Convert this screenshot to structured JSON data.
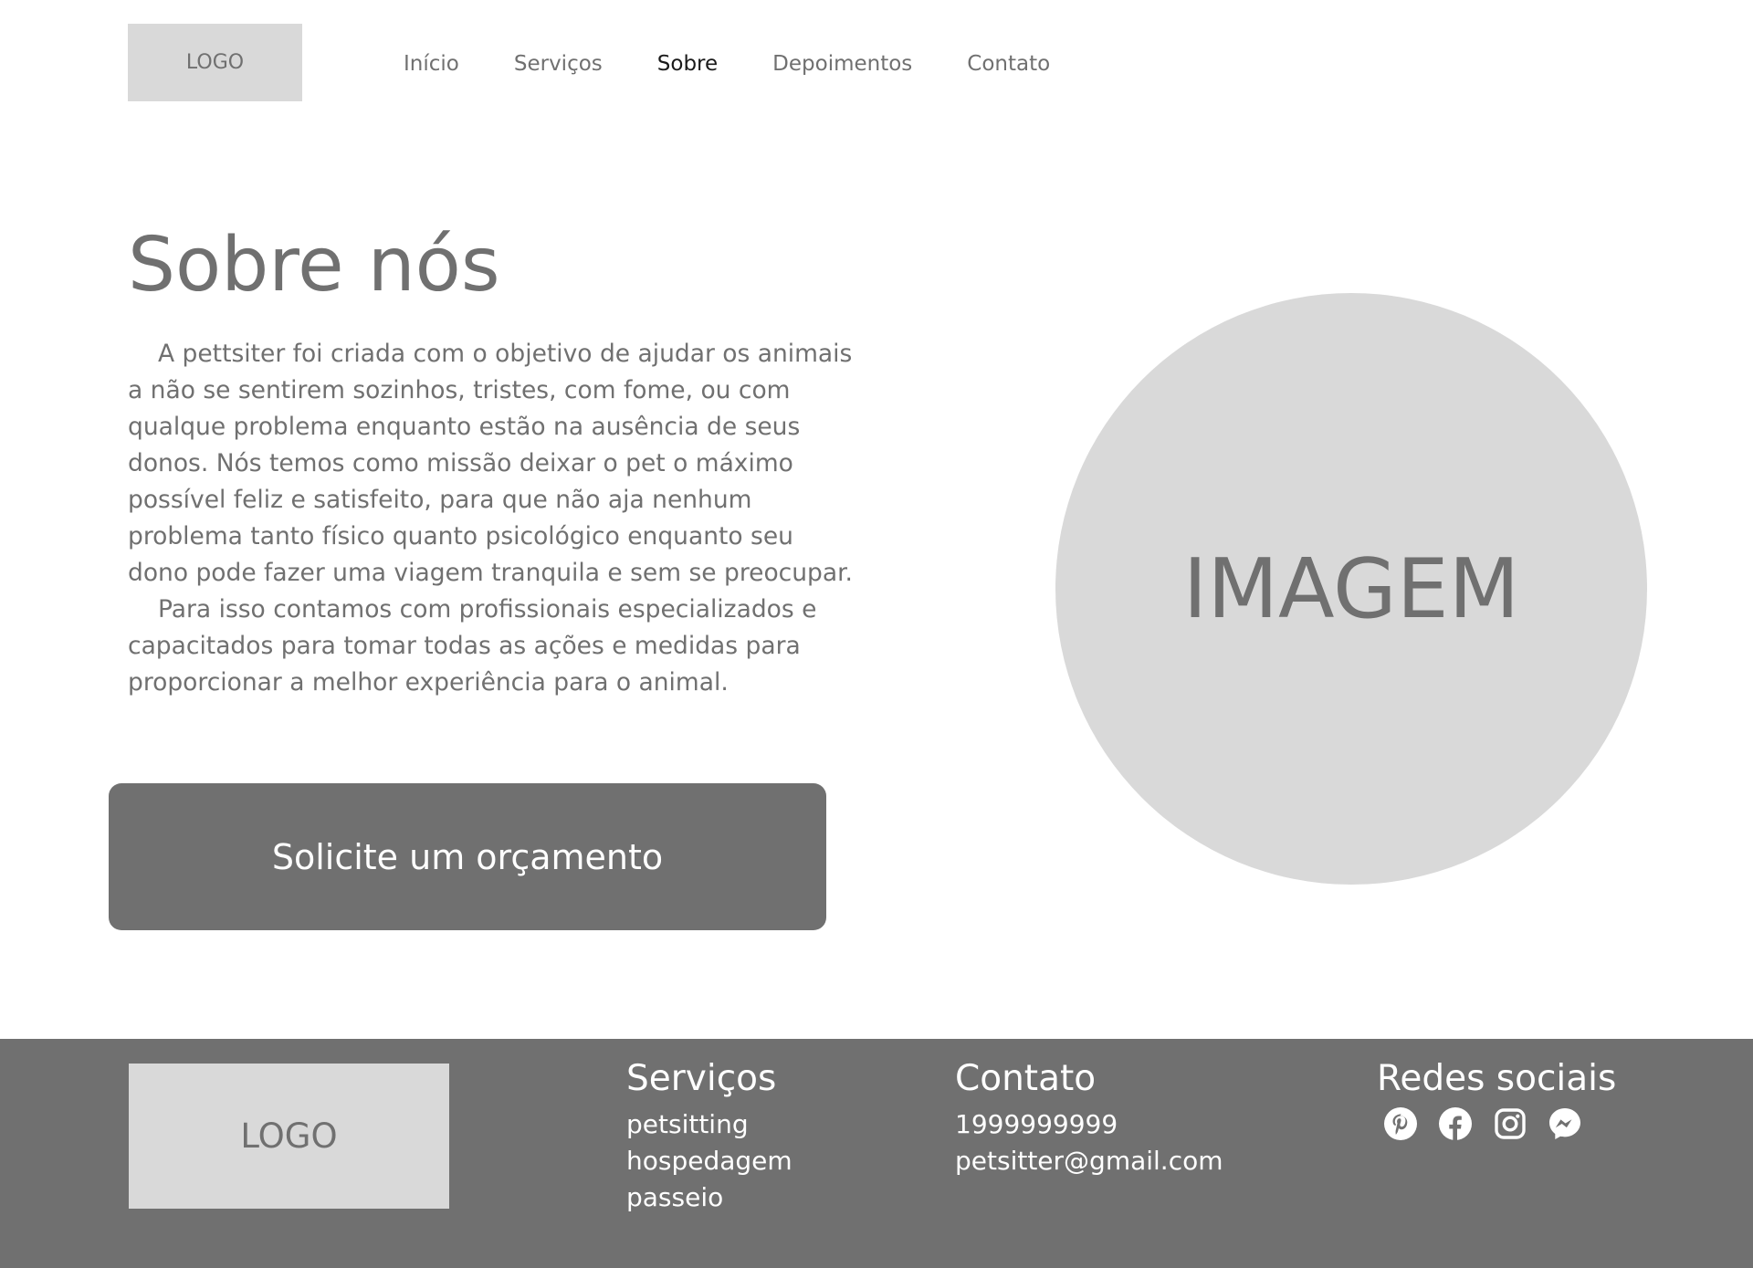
{
  "header": {
    "logo_text": "LOGO",
    "nav": [
      {
        "label": "Início"
      },
      {
        "label": "Serviços"
      },
      {
        "label": "Sobre",
        "active": true
      },
      {
        "label": "Depoimentos"
      },
      {
        "label": "Contato"
      }
    ]
  },
  "about": {
    "title": "Sobre nós",
    "paragraphs": [
      "A pettsiter foi criada com o objetivo de ajudar os animais a não se sentirem sozinhos, tristes, com fome, ou com qualque problema enquanto estão na ausência de seus donos. Nós temos como missão deixar o pet o máximo possível feliz e satisfeito, para que não aja nenhum problema tanto físico quanto psicológico enquanto seu dono pode fazer uma viagem tranquila e sem se preocupar.",
      "Para isso contamos com profissionais especializados e capacitados para tomar todas as ações e medidas para proporcionar a melhor experiência para o animal."
    ],
    "cta_label": "Solicite um orçamento",
    "image_placeholder": "IMAGEM"
  },
  "footer": {
    "logo_text": "LOGO",
    "services": {
      "heading": "Serviços",
      "items": [
        "petsitting",
        "hospedagem",
        "passeio"
      ]
    },
    "contact": {
      "heading": "Contato",
      "phone": "1999999999",
      "email": "petsitter@gmail.com"
    },
    "social": {
      "heading": "Redes sociais",
      "icons": [
        "pinterest-icon",
        "facebook-icon",
        "instagram-icon",
        "messenger-icon"
      ]
    }
  },
  "colors": {
    "placeholder_gray": "#d9d9d9",
    "primary_gray": "#707070",
    "active_nav": "#1a1a1a",
    "white": "#ffffff"
  }
}
